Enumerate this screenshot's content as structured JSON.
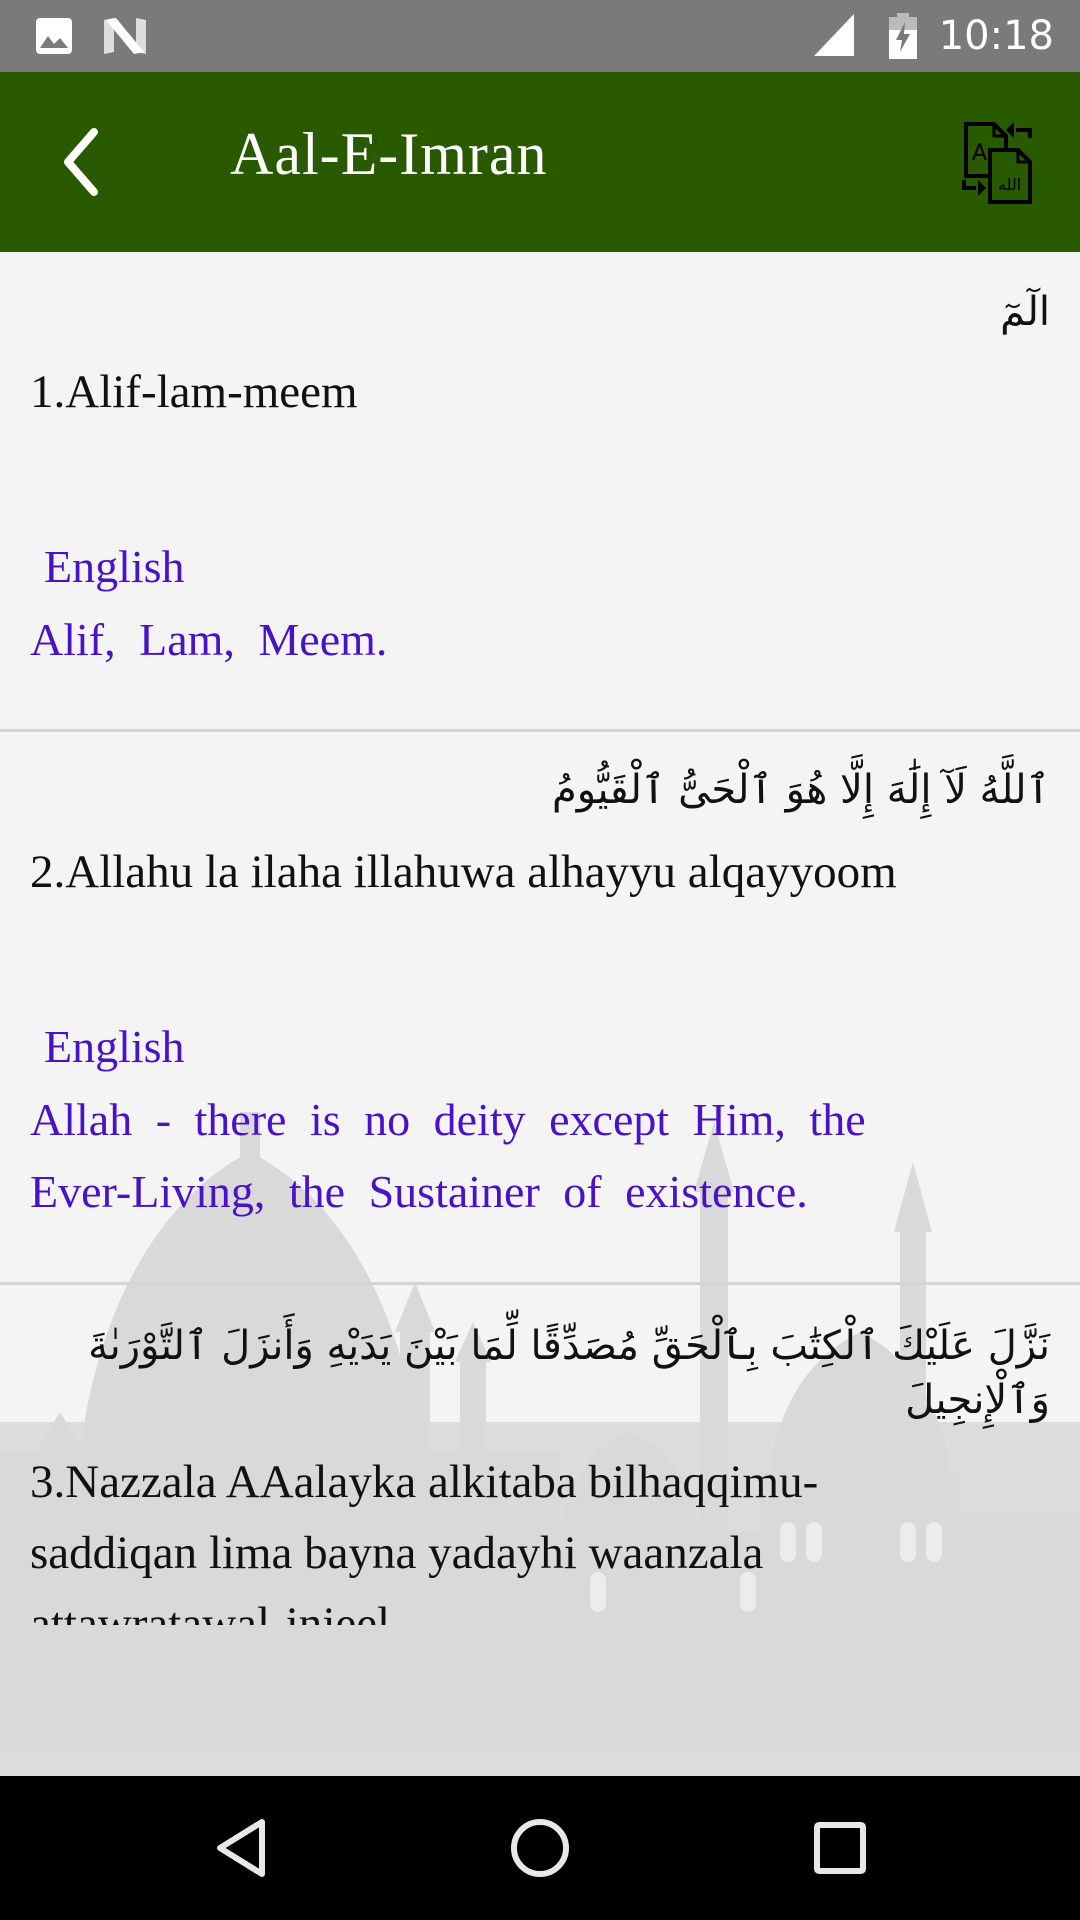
{
  "status_bar": {
    "time": "10:18",
    "icons": [
      "image-notification-icon",
      "n-notification-icon",
      "signal-icon",
      "battery-charging-icon"
    ]
  },
  "app_bar": {
    "title": "Aal-E-Imran",
    "back_icon": "chevron-left-icon",
    "action_icon": "translate-document-icon"
  },
  "verses": [
    {
      "arabic": "الٓمٓ",
      "transliteration": "1.Alif-lam-meem",
      "translation_label": "English",
      "translation": "Alif, Lam, Meem."
    },
    {
      "arabic": "ٱللَّهُ لَآ إِلَٰهَ إِلَّا هُوَ ٱلْحَىُّ ٱلْقَيُّومُ",
      "transliteration": "2.Allahu la ilaha illahuwa alhayyu alqayyoom",
      "translation_label": "English",
      "translation_lines": [
        "Allah -  there is no deity except Him, the",
        "Ever-Living, the Sustainer of existence."
      ]
    },
    {
      "arabic_lines": [
        "نَزَّلَ عَلَيْكَ ٱلْكِتَٰبَ بِٱلْحَقِّ مُصَدِّقًا لِّمَا بَيْنَ يَدَيْهِ وَأَنزَلَ ٱلتَّوْرَىٰةَ",
        "وَٱلْإِنجِيلَ"
      ],
      "transliteration_lines": [
        "3.Nazzala AAalayka alkitaba bilhaqqimu-",
        "saddiqan lima bayna yadayhi waanzala",
        "attawratawal-injeel"
      ]
    }
  ],
  "nav_bar": {
    "buttons": [
      "back-triangle-icon",
      "home-circle-icon",
      "recents-square-icon"
    ]
  },
  "colors": {
    "app_bar": "#2a5a00",
    "status_bar": "#7a7a7a",
    "translation_text": "#4a12c8",
    "background": "#f4f4f4"
  }
}
